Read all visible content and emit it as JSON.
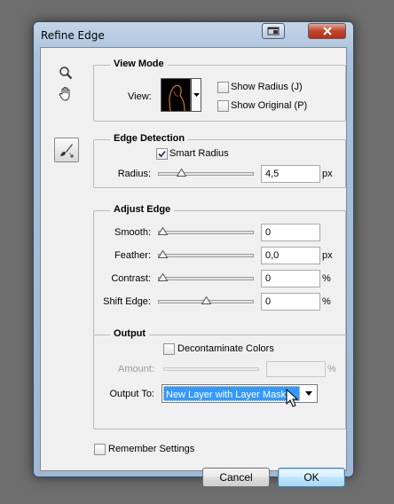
{
  "window": {
    "title": "Refine Edge"
  },
  "tools": {
    "zoom_icon": "magnifier-icon",
    "hand_icon": "hand-icon",
    "refine_icon": "refine-radius-brush-icon"
  },
  "view_mode": {
    "title": "View Mode",
    "view_label": "View:",
    "show_radius": {
      "label": "Show Radius (J)",
      "checked": false
    },
    "show_original": {
      "label": "Show Original (P)",
      "checked": false
    }
  },
  "edge_detection": {
    "title": "Edge Detection",
    "smart_radius": {
      "label": "Smart Radius",
      "checked": true
    },
    "radius": {
      "label": "Radius:",
      "value": "4,5",
      "unit": "px",
      "slider_fraction": 0.2
    }
  },
  "adjust_edge": {
    "title": "Adjust Edge",
    "rows": [
      {
        "label": "Smooth:",
        "value": "0",
        "unit": "",
        "slider_fraction": 0.0
      },
      {
        "label": "Feather:",
        "value": "0,0",
        "unit": "px",
        "slider_fraction": 0.0
      },
      {
        "label": "Contrast:",
        "value": "0",
        "unit": "%",
        "slider_fraction": 0.0
      },
      {
        "label": "Shift Edge:",
        "value": "0",
        "unit": "%",
        "slider_fraction": 0.5
      }
    ]
  },
  "output": {
    "title": "Output",
    "decontaminate": {
      "label": "Decontaminate Colors",
      "checked": false
    },
    "amount": {
      "label": "Amount:",
      "value": "",
      "unit": "%"
    },
    "output_to": {
      "label": "Output To:",
      "selected": "New Layer with Layer Mask"
    }
  },
  "remember": {
    "label": "Remember Settings",
    "checked": false
  },
  "buttons": {
    "cancel": "Cancel",
    "ok": "OK"
  },
  "colors": {
    "selection": "#3399ff",
    "window_frame": "#a9c1db",
    "close_button": "#c1452b"
  }
}
